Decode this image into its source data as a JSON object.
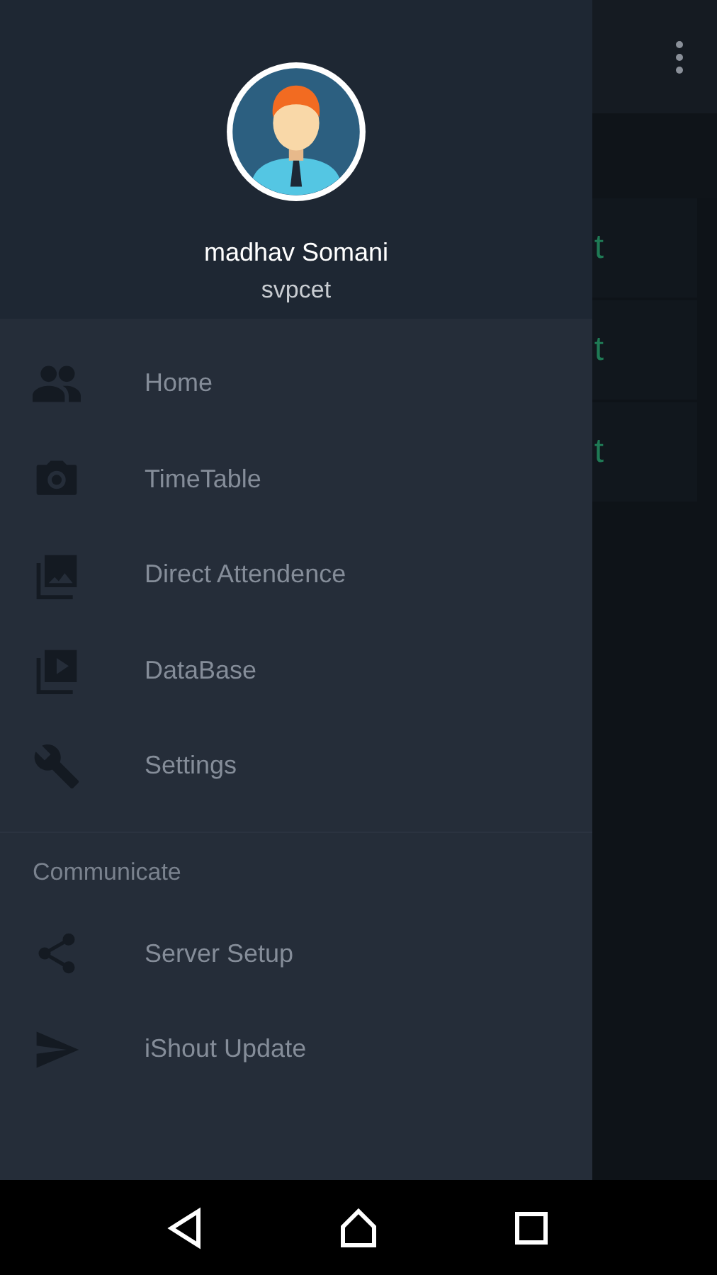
{
  "background": {
    "cards": [
      {
        "text": "t"
      },
      {
        "text": "t"
      },
      {
        "text": "t"
      }
    ]
  },
  "drawer": {
    "profile": {
      "name": "madhav Somani",
      "subtitle": "svpcet"
    },
    "items": [
      {
        "label": "Home"
      },
      {
        "label": "TimeTable"
      },
      {
        "label": "Direct Attendence"
      },
      {
        "label": "DataBase"
      },
      {
        "label": "Settings"
      }
    ],
    "sections": [
      {
        "title": "Communicate",
        "items": [
          {
            "label": "Server Setup"
          },
          {
            "label": "iShout Update"
          }
        ]
      }
    ]
  }
}
